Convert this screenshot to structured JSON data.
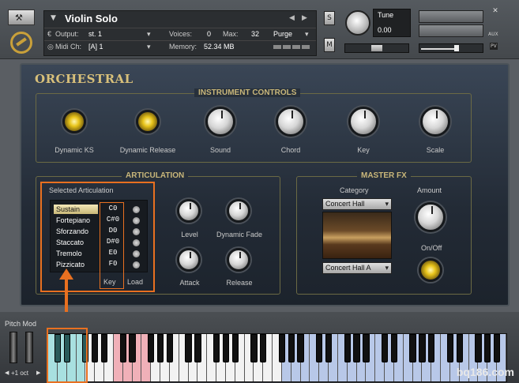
{
  "header": {
    "instrument_name": "Violin Solo",
    "output_label": "Output:",
    "output_value": "st. 1",
    "voices_label": "Voices:",
    "voices_value": "0",
    "max_label": "Max:",
    "max_value": "32",
    "purge_label": "Purge",
    "midi_label": "Midi Ch:",
    "midi_value": "[A] 1",
    "memory_label": "Memory:",
    "memory_value": "52.34 MB",
    "solo_label": "S",
    "mute_label": "M",
    "tune_label": "Tune",
    "tune_value": "0.00",
    "close_label": "✕",
    "aux_label": "AUX",
    "pv_label": "PV"
  },
  "panel": {
    "title": "ORCHESTRAL",
    "instrument_controls": {
      "title": "INSTRUMENT CONTROLS",
      "controls": [
        "Dynamic KS",
        "Dynamic Release",
        "Sound",
        "Chord",
        "Key",
        "Scale"
      ]
    },
    "articulation": {
      "title": "ARTICULATION",
      "selected_label": "Selected Articulation",
      "items": [
        {
          "name": "Sustain",
          "key": "C0"
        },
        {
          "name": "Fortepiano",
          "key": "C#0"
        },
        {
          "name": "Sforzando",
          "key": "D0"
        },
        {
          "name": "Staccato",
          "key": "D#0"
        },
        {
          "name": "Tremolo",
          "key": "E0"
        },
        {
          "name": "Pizzicato",
          "key": "F0"
        }
      ],
      "key_col": "Key",
      "load_col": "Load",
      "knobs": [
        "Level",
        "Dynamic Fade",
        "Attack",
        "Release"
      ]
    },
    "master_fx": {
      "title": "MASTER FX",
      "category_label": "Category",
      "category_value": "Concert Hall",
      "preset_value": "Concert Hall A",
      "amount_label": "Amount",
      "onoff_label": "On/Off"
    }
  },
  "keyboard": {
    "pitch_label": "Pitch Mod",
    "octave_label": "+1 oct"
  },
  "watermark": "bq186.com",
  "colors": {
    "highlight": "#e87020",
    "panel_gold": "#c9b77a",
    "key_teal": "#a8e0e0",
    "key_pink": "#f0b0b8",
    "key_blue": "#b8c8e8"
  }
}
